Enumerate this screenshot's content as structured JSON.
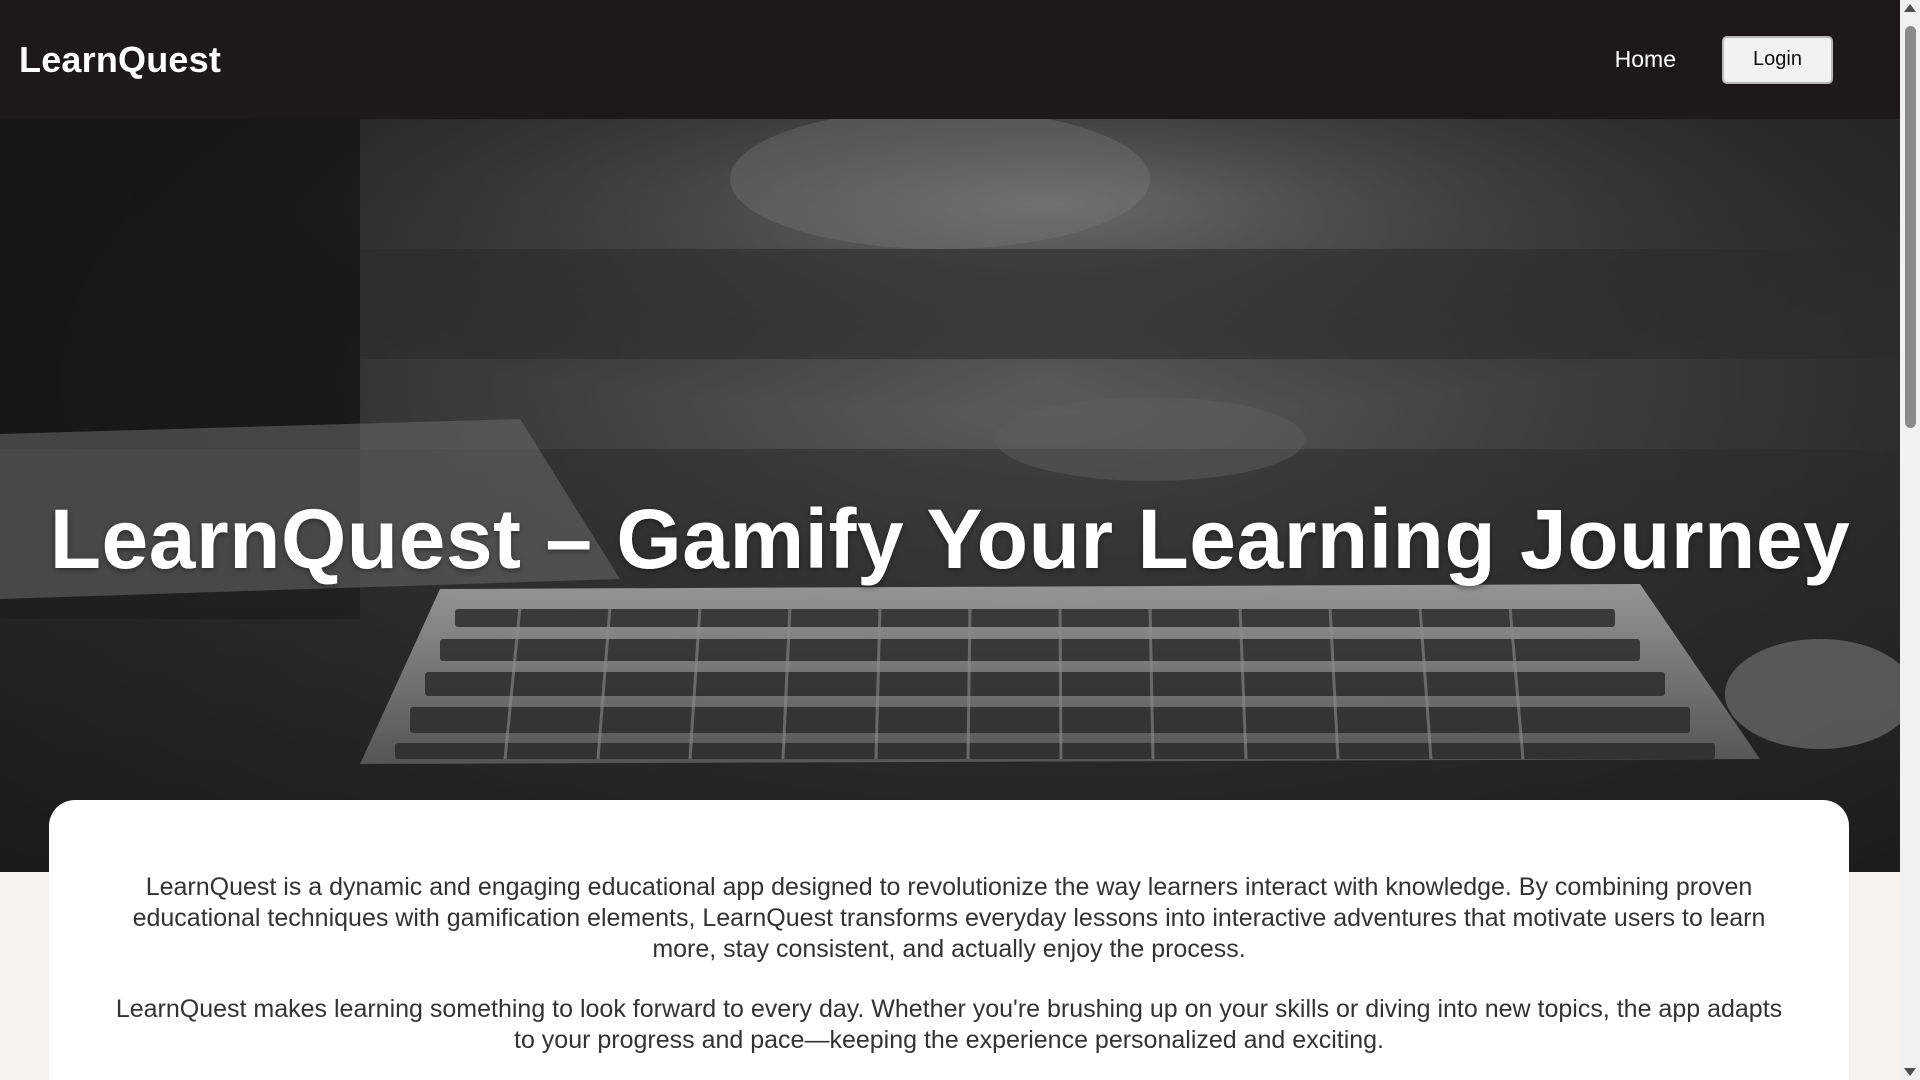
{
  "navbar": {
    "brand": "LearnQuest",
    "home_label": "Home",
    "login_label": "Login"
  },
  "hero": {
    "title": "LearnQuest – Gamify Your Learning Journey",
    "background_image": "keyboard-on-desk"
  },
  "content": {
    "paragraphs": [
      "LearnQuest is a dynamic and engaging educational app designed to revolutionize the way learners interact with knowledge. By combining proven educational techniques with gamification elements, LearnQuest transforms everyday lessons into interactive adventures that motivate users to learn more, stay consistent, and actually enjoy the process.",
      "LearnQuest makes learning something to look forward to every day. Whether you're brushing up on your skills or diving into new topics, the app adapts to your progress and pace—keeping the experience personalized and exciting."
    ]
  },
  "colors": {
    "navbar_bg": "#1b1919",
    "page_bg": "#f4f3f2",
    "text": "#333333"
  }
}
